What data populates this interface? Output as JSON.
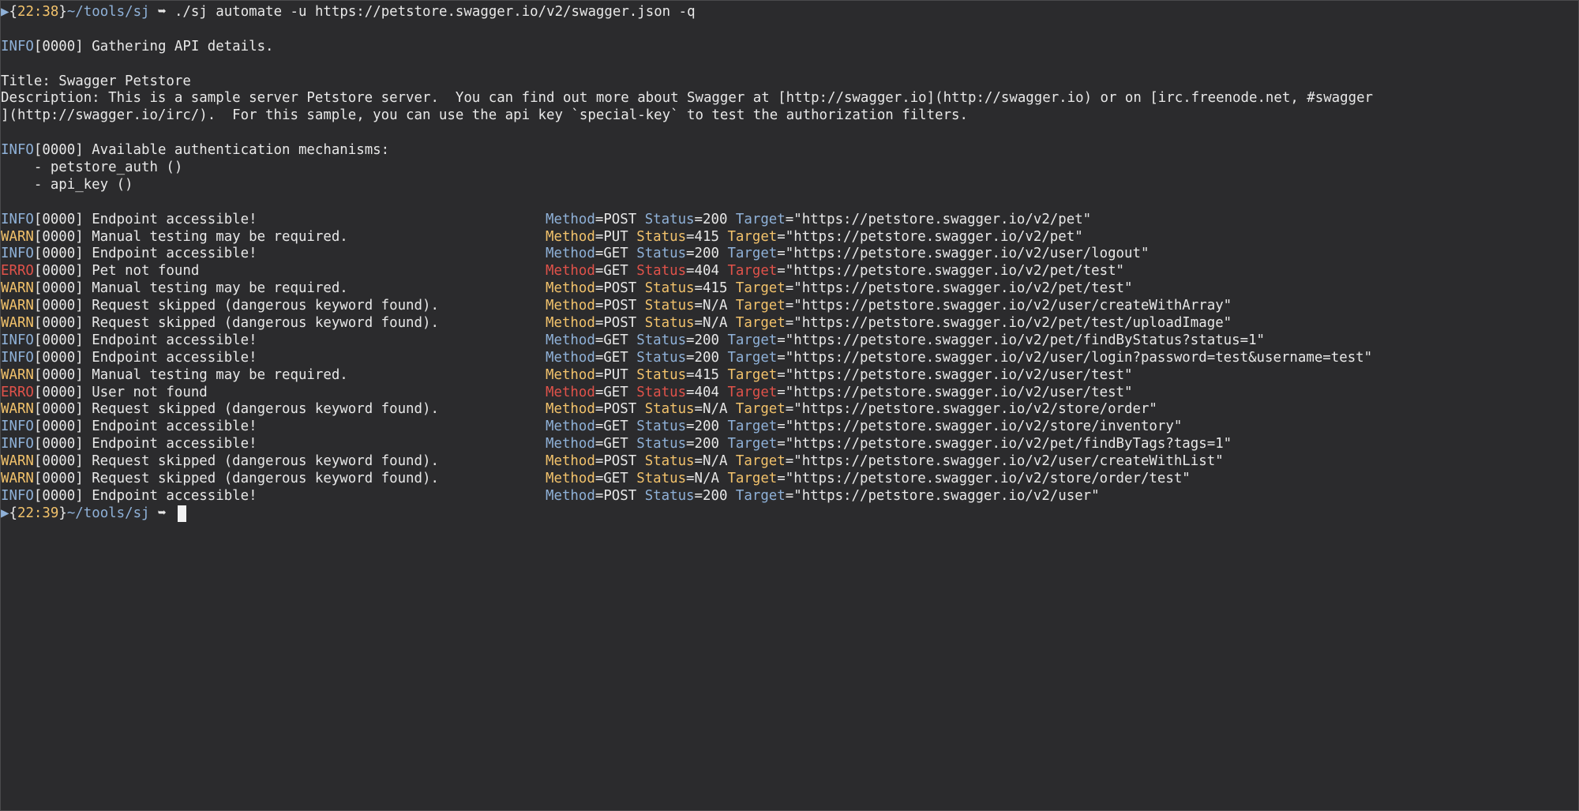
{
  "prompt1": {
    "arrow": "▶",
    "time": "22:38",
    "path": "~/tools/sj",
    "symbol": "➥",
    "command": " ./sj automate -u https://petstore.swagger.io/v2/swagger.json -q"
  },
  "gathering": {
    "level": "INFO",
    "code": "[0000]",
    "text": " Gathering API details."
  },
  "title_line": "Title: Swagger Petstore",
  "description_line1": "Description: This is a sample server Petstore server.  You can find out more about Swagger at [http://swagger.io](http://swagger.io) or on [irc.freenode.net, #swagger",
  "description_line2": "](http://swagger.io/irc/).  For this sample, you can use the api key `special-key` to test the authorization filters.",
  "auth": {
    "level": "INFO",
    "code": "[0000]",
    "text": " Available authentication mechanisms:",
    "items": [
      "    - petstore_auth ()",
      "    - api_key ()"
    ]
  },
  "results": [
    {
      "level": "INFO",
      "code": "[0000]",
      "msg": " Endpoint accessible!",
      "method": "POST",
      "status": "200",
      "target": "\"https://petstore.swagger.io/v2/pet\""
    },
    {
      "level": "WARN",
      "code": "[0000]",
      "msg": " Manual testing may be required.",
      "method": "PUT",
      "status": "415",
      "target": "\"https://petstore.swagger.io/v2/pet\""
    },
    {
      "level": "INFO",
      "code": "[0000]",
      "msg": " Endpoint accessible!",
      "method": "GET",
      "status": "200",
      "target": "\"https://petstore.swagger.io/v2/user/logout\""
    },
    {
      "level": "ERRO",
      "code": "[0000]",
      "msg": " Pet not found",
      "method": "GET",
      "status": "404",
      "target": "\"https://petstore.swagger.io/v2/pet/test\""
    },
    {
      "level": "WARN",
      "code": "[0000]",
      "msg": " Manual testing may be required.",
      "method": "POST",
      "status": "415",
      "target": "\"https://petstore.swagger.io/v2/pet/test\""
    },
    {
      "level": "WARN",
      "code": "[0000]",
      "msg": " Request skipped (dangerous keyword found).",
      "method": "POST",
      "status": "N/A",
      "target": "\"https://petstore.swagger.io/v2/user/createWithArray\""
    },
    {
      "level": "WARN",
      "code": "[0000]",
      "msg": " Request skipped (dangerous keyword found).",
      "method": "POST",
      "status": "N/A",
      "target": "\"https://petstore.swagger.io/v2/pet/test/uploadImage\""
    },
    {
      "level": "INFO",
      "code": "[0000]",
      "msg": " Endpoint accessible!",
      "method": "GET",
      "status": "200",
      "target": "\"https://petstore.swagger.io/v2/pet/findByStatus?status=1\""
    },
    {
      "level": "INFO",
      "code": "[0000]",
      "msg": " Endpoint accessible!",
      "method": "GET",
      "status": "200",
      "target": "\"https://petstore.swagger.io/v2/user/login?password=test&username=test\""
    },
    {
      "level": "WARN",
      "code": "[0000]",
      "msg": " Manual testing may be required.",
      "method": "PUT",
      "status": "415",
      "target": "\"https://petstore.swagger.io/v2/user/test\""
    },
    {
      "level": "ERRO",
      "code": "[0000]",
      "msg": " User not found",
      "method": "GET",
      "status": "404",
      "target": "\"https://petstore.swagger.io/v2/user/test\""
    },
    {
      "level": "WARN",
      "code": "[0000]",
      "msg": " Request skipped (dangerous keyword found).",
      "method": "POST",
      "status": "N/A",
      "target": "\"https://petstore.swagger.io/v2/store/order\""
    },
    {
      "level": "INFO",
      "code": "[0000]",
      "msg": " Endpoint accessible!",
      "method": "GET",
      "status": "200",
      "target": "\"https://petstore.swagger.io/v2/store/inventory\""
    },
    {
      "level": "INFO",
      "code": "[0000]",
      "msg": " Endpoint accessible!",
      "method": "GET",
      "status": "200",
      "target": "\"https://petstore.swagger.io/v2/pet/findByTags?tags=1\""
    },
    {
      "level": "WARN",
      "code": "[0000]",
      "msg": " Request skipped (dangerous keyword found).",
      "method": "POST",
      "status": "N/A",
      "target": "\"https://petstore.swagger.io/v2/user/createWithList\""
    },
    {
      "level": "WARN",
      "code": "[0000]",
      "msg": " Request skipped (dangerous keyword found).",
      "method": "GET",
      "status": "N/A",
      "target": "\"https://petstore.swagger.io/v2/store/order/test\""
    },
    {
      "level": "INFO",
      "code": "[0000]",
      "msg": " Endpoint accessible!",
      "method": "POST",
      "status": "200",
      "target": "\"https://petstore.swagger.io/v2/user\""
    }
  ],
  "labels": {
    "method": "Method",
    "status": "Status",
    "target": "Target",
    "eq": "="
  },
  "prompt2": {
    "arrow": "▶",
    "time": "22:39",
    "path": "~/tools/sj",
    "symbol": "➥"
  },
  "colors": {
    "background": "#2b2b2d",
    "text": "#e8e8e8",
    "info": "#8fb1d8",
    "warn": "#f2c26b",
    "erro": "#e0524a"
  }
}
